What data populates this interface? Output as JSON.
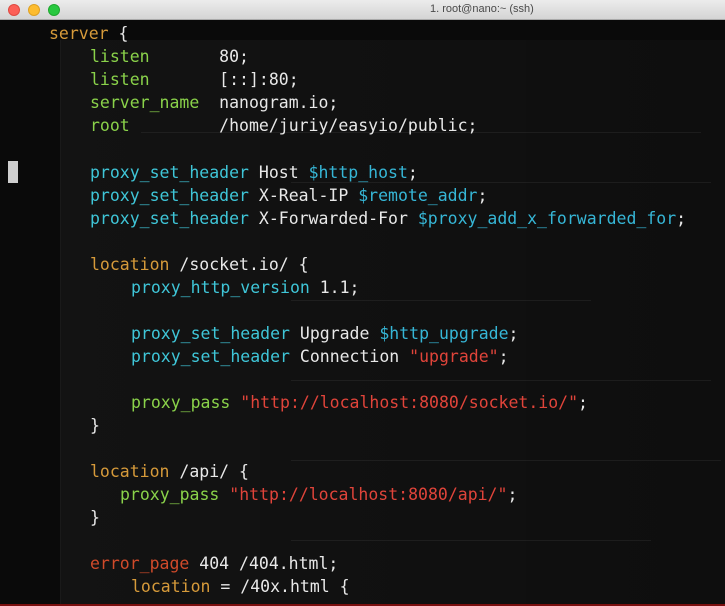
{
  "window": {
    "title": "1. root@nano:~ (ssh)"
  },
  "colors": {
    "directive_orange": "#d69a3a",
    "directive_green": "#8ad24a",
    "directive_cyan": "#3fc6d8",
    "variable": "#36b6d6",
    "string": "#e0443a",
    "text": "#e8e8e8"
  },
  "code": {
    "l1": {
      "kw": "server",
      "rest": " {"
    },
    "l2": {
      "kw": "listen",
      "pad": "       ",
      "val": "80;"
    },
    "l3": {
      "kw": "listen",
      "pad": "       ",
      "val": "[::]:80;"
    },
    "l4": {
      "kw": "server_name",
      "pad": "  ",
      "val": "nanogram.io;"
    },
    "l5": {
      "kw": "root",
      "pad": "         ",
      "val": "/home/juriy/easyio/public;"
    },
    "l7": {
      "kw": "proxy_set_header",
      "arg": " Host ",
      "var": "$http_host",
      "end": ";"
    },
    "l8": {
      "kw": "proxy_set_header",
      "arg": " X-Real-IP ",
      "var": "$remote_addr",
      "end": ";"
    },
    "l9": {
      "kw": "proxy_set_header",
      "arg": " X-Forwarded-For ",
      "var": "$proxy_add_x_forwarded_for",
      "end": ";"
    },
    "l11": {
      "kw": "location",
      "arg": " /socket.io/ {"
    },
    "l12": {
      "kw": "proxy_http_version",
      "arg": " 1.1;"
    },
    "l14": {
      "kw": "proxy_set_header",
      "arg": " Upgrade ",
      "var": "$http_upgrade",
      "end": ";"
    },
    "l15": {
      "kw": "proxy_set_header",
      "arg": " Connection ",
      "str": "\"upgrade\"",
      "end": ";"
    },
    "l17": {
      "kw": "proxy_pass",
      "arg": " ",
      "str": "\"http://localhost:8080/socket.io/\"",
      "end": ";"
    },
    "l18": {
      "text": "}"
    },
    "l20": {
      "kw": "location",
      "arg": " /api/ {"
    },
    "l21": {
      "kw": "proxy_pass",
      "arg": " ",
      "str": "\"http://localhost:8080/api/\"",
      "end": ";"
    },
    "l22": {
      "text": "}"
    },
    "l24": {
      "kw": "error_page",
      "arg": " 404 /404.html;"
    },
    "l25": {
      "kw": "location",
      "arg": " = /40x.html {"
    }
  }
}
